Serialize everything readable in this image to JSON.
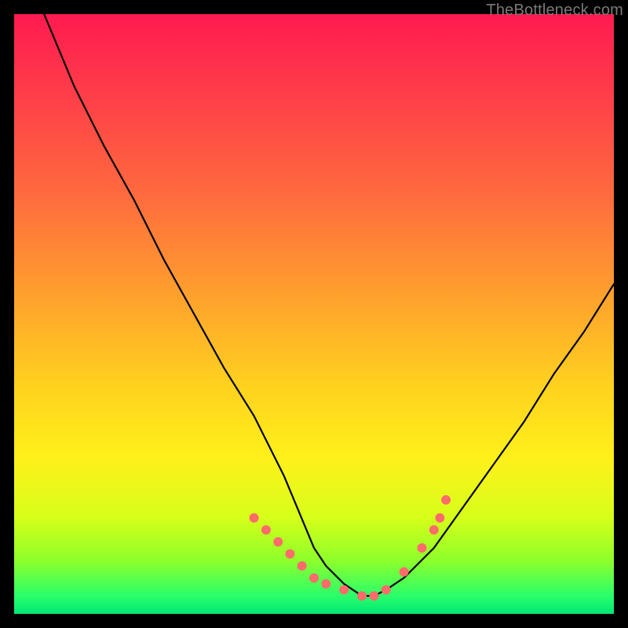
{
  "watermark": "TheBottleneck.com",
  "chart_data": {
    "type": "line",
    "title": "",
    "xlabel": "",
    "ylabel": "",
    "xlim": [
      0,
      100
    ],
    "ylim": [
      0,
      100
    ],
    "series": [
      {
        "name": "bottleneck-curve",
        "x": [
          5,
          10,
          15,
          20,
          25,
          30,
          35,
          40,
          45,
          50,
          52,
          55,
          58,
          60,
          62,
          65,
          70,
          75,
          80,
          85,
          90,
          95,
          100
        ],
        "y": [
          100,
          88,
          78,
          69,
          59,
          50,
          41,
          33,
          23,
          11,
          8,
          5,
          3,
          3,
          4,
          6,
          11,
          18,
          25,
          32,
          40,
          47,
          55
        ]
      }
    ],
    "markers": {
      "name": "highlight-dots",
      "color": "#ff6b6b",
      "x": [
        40,
        42,
        44,
        46,
        48,
        50,
        52,
        55,
        58,
        60,
        62,
        65,
        68,
        70,
        71,
        72
      ],
      "y": [
        16,
        14,
        12,
        10,
        8,
        6,
        5,
        4,
        3,
        3,
        4,
        7,
        11,
        14,
        16,
        19
      ]
    },
    "gradient_stops": [
      {
        "pos": 0,
        "color": "#ff1a50"
      },
      {
        "pos": 12,
        "color": "#ff3a4a"
      },
      {
        "pos": 30,
        "color": "#ff6a3e"
      },
      {
        "pos": 45,
        "color": "#ff9a2f"
      },
      {
        "pos": 62,
        "color": "#ffd21f"
      },
      {
        "pos": 74,
        "color": "#fff01a"
      },
      {
        "pos": 84,
        "color": "#d6ff1a"
      },
      {
        "pos": 91,
        "color": "#8fff2a"
      },
      {
        "pos": 97,
        "color": "#2aff6a"
      },
      {
        "pos": 100,
        "color": "#00e874"
      }
    ]
  }
}
